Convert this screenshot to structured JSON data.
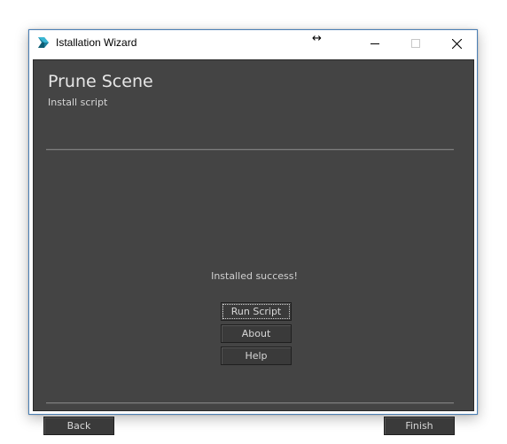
{
  "window": {
    "title": "Istallation Wizard",
    "resize_cursor_glyph": "↔",
    "app_icon": "app-logo-icon",
    "controls": {
      "minimize_icon": "minimize-icon",
      "maximize_icon": "maximize-icon",
      "close_icon": "close-icon"
    }
  },
  "header": {
    "title": "Prune Scene",
    "subtitle": "Install script"
  },
  "main": {
    "status": "Installed success!",
    "buttons": {
      "run_script": "Run Script",
      "about": "About",
      "help": "Help"
    }
  },
  "footer": {
    "back_label": "Back",
    "finish_label": "Finish"
  },
  "colors": {
    "panel_background": "#444444",
    "button_background": "#3a3a3a",
    "text": "#d8d8d8",
    "window_border": "#4a7fb5"
  }
}
